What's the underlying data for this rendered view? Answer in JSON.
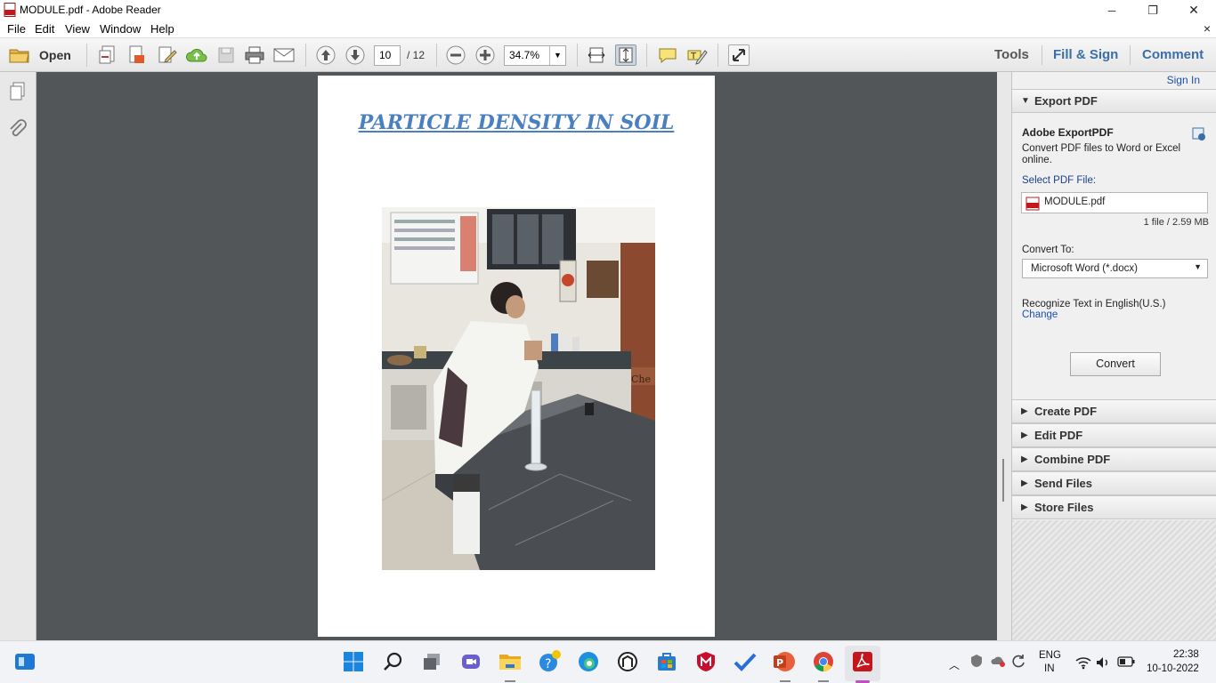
{
  "window": {
    "title": "MODULE.pdf - Adobe Reader",
    "minimize_glyph": "─",
    "maximize_glyph": "❐",
    "close_glyph": "✕"
  },
  "menu": {
    "items": [
      "File",
      "Edit",
      "View",
      "Window",
      "Help"
    ],
    "doc_close_glyph": "×"
  },
  "toolbar": {
    "open_label": "Open",
    "page_current": "10",
    "page_total": "/ 12",
    "zoom": "34.7%",
    "tools_label": "Tools",
    "fill_sign_label": "Fill & Sign",
    "comment_label": "Comment"
  },
  "document": {
    "heading": "PARTICLE DENSITY IN SOIL",
    "photo_sign_text": "Che"
  },
  "right_pane": {
    "sign_in": "Sign In",
    "export_title": "Export PDF",
    "service_name": "Adobe ExportPDF",
    "description": "Convert PDF files to Word or Excel online.",
    "select_label": "Select PDF File:",
    "file_name": "MODULE.pdf",
    "file_info": "1 file / 2.59 MB",
    "convert_to_label": "Convert To:",
    "convert_to_value": "Microsoft Word (*.docx)",
    "recognize_text": "Recognize Text in English(U.S.)",
    "change_link": "Change",
    "convert_button": "Convert",
    "sections": [
      "Create PDF",
      "Edit PDF",
      "Combine PDF",
      "Send Files",
      "Store Files"
    ]
  },
  "taskbar": {
    "language_line1": "ENG",
    "language_line2": "IN",
    "time": "22:38",
    "date": "10-10-2022"
  },
  "colors": {
    "accent_link": "#1a50b0",
    "heading_blue": "#4a7fc0",
    "doc_background": "#525659",
    "toolbar_link": "#3b6fa8"
  }
}
